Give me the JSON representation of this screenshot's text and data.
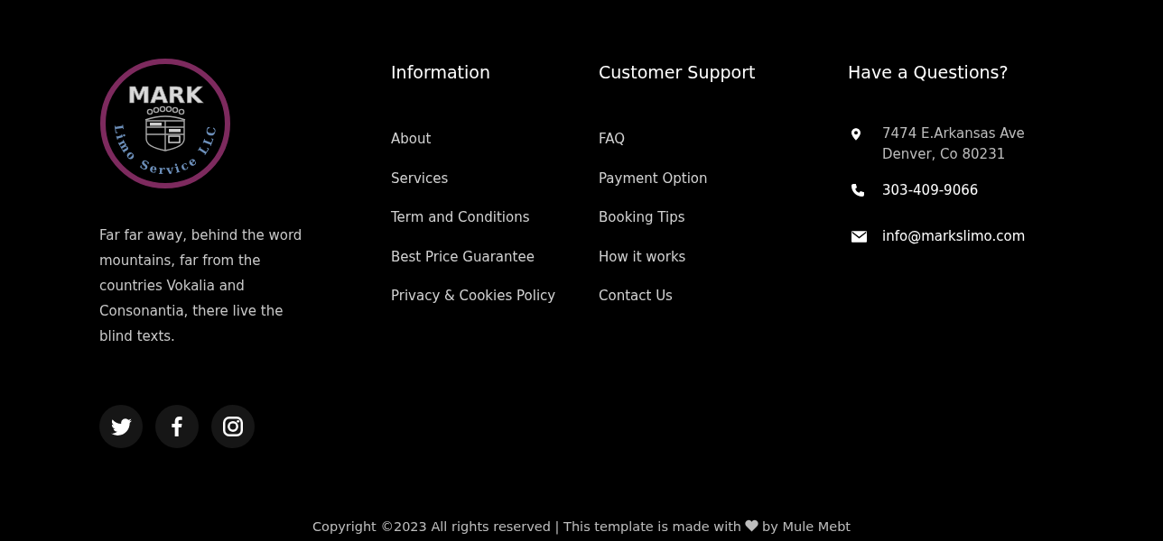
{
  "logo": {
    "title": "MARK",
    "subtitle_words": [
      "Limo",
      "Service",
      "LLC"
    ]
  },
  "about": {
    "text": "Far far away, behind the word mountains, far from the countries Vokalia and Consonantia, there live the blind texts."
  },
  "social": [
    {
      "kind": "bird"
    },
    {
      "kind": "letter-f"
    },
    {
      "kind": "camera"
    }
  ],
  "columns": [
    {
      "heading": "Information",
      "links": [
        "About",
        "Services",
        "Term and Conditions",
        "Best Price Guarantee",
        "Privacy & Cookies Policy"
      ]
    },
    {
      "heading": "Customer Support",
      "links": [
        "FAQ",
        "Payment Option",
        "Booking Tips",
        "How it works",
        "Contact Us"
      ]
    }
  ],
  "contact": {
    "heading": "Have a Questions?",
    "items": [
      {
        "kind": "address",
        "lines": [
          "7474 E.Arkansas Ave",
          "Denver, Co 80231"
        ]
      },
      {
        "kind": "phone",
        "text": "303-409-9066"
      },
      {
        "kind": "email",
        "text": "info@markslimo.com"
      }
    ]
  },
  "copyright": {
    "text": "Copyright ©2023 All rights reserved | This template is made with",
    "credit": "by Mule Mebt"
  }
}
